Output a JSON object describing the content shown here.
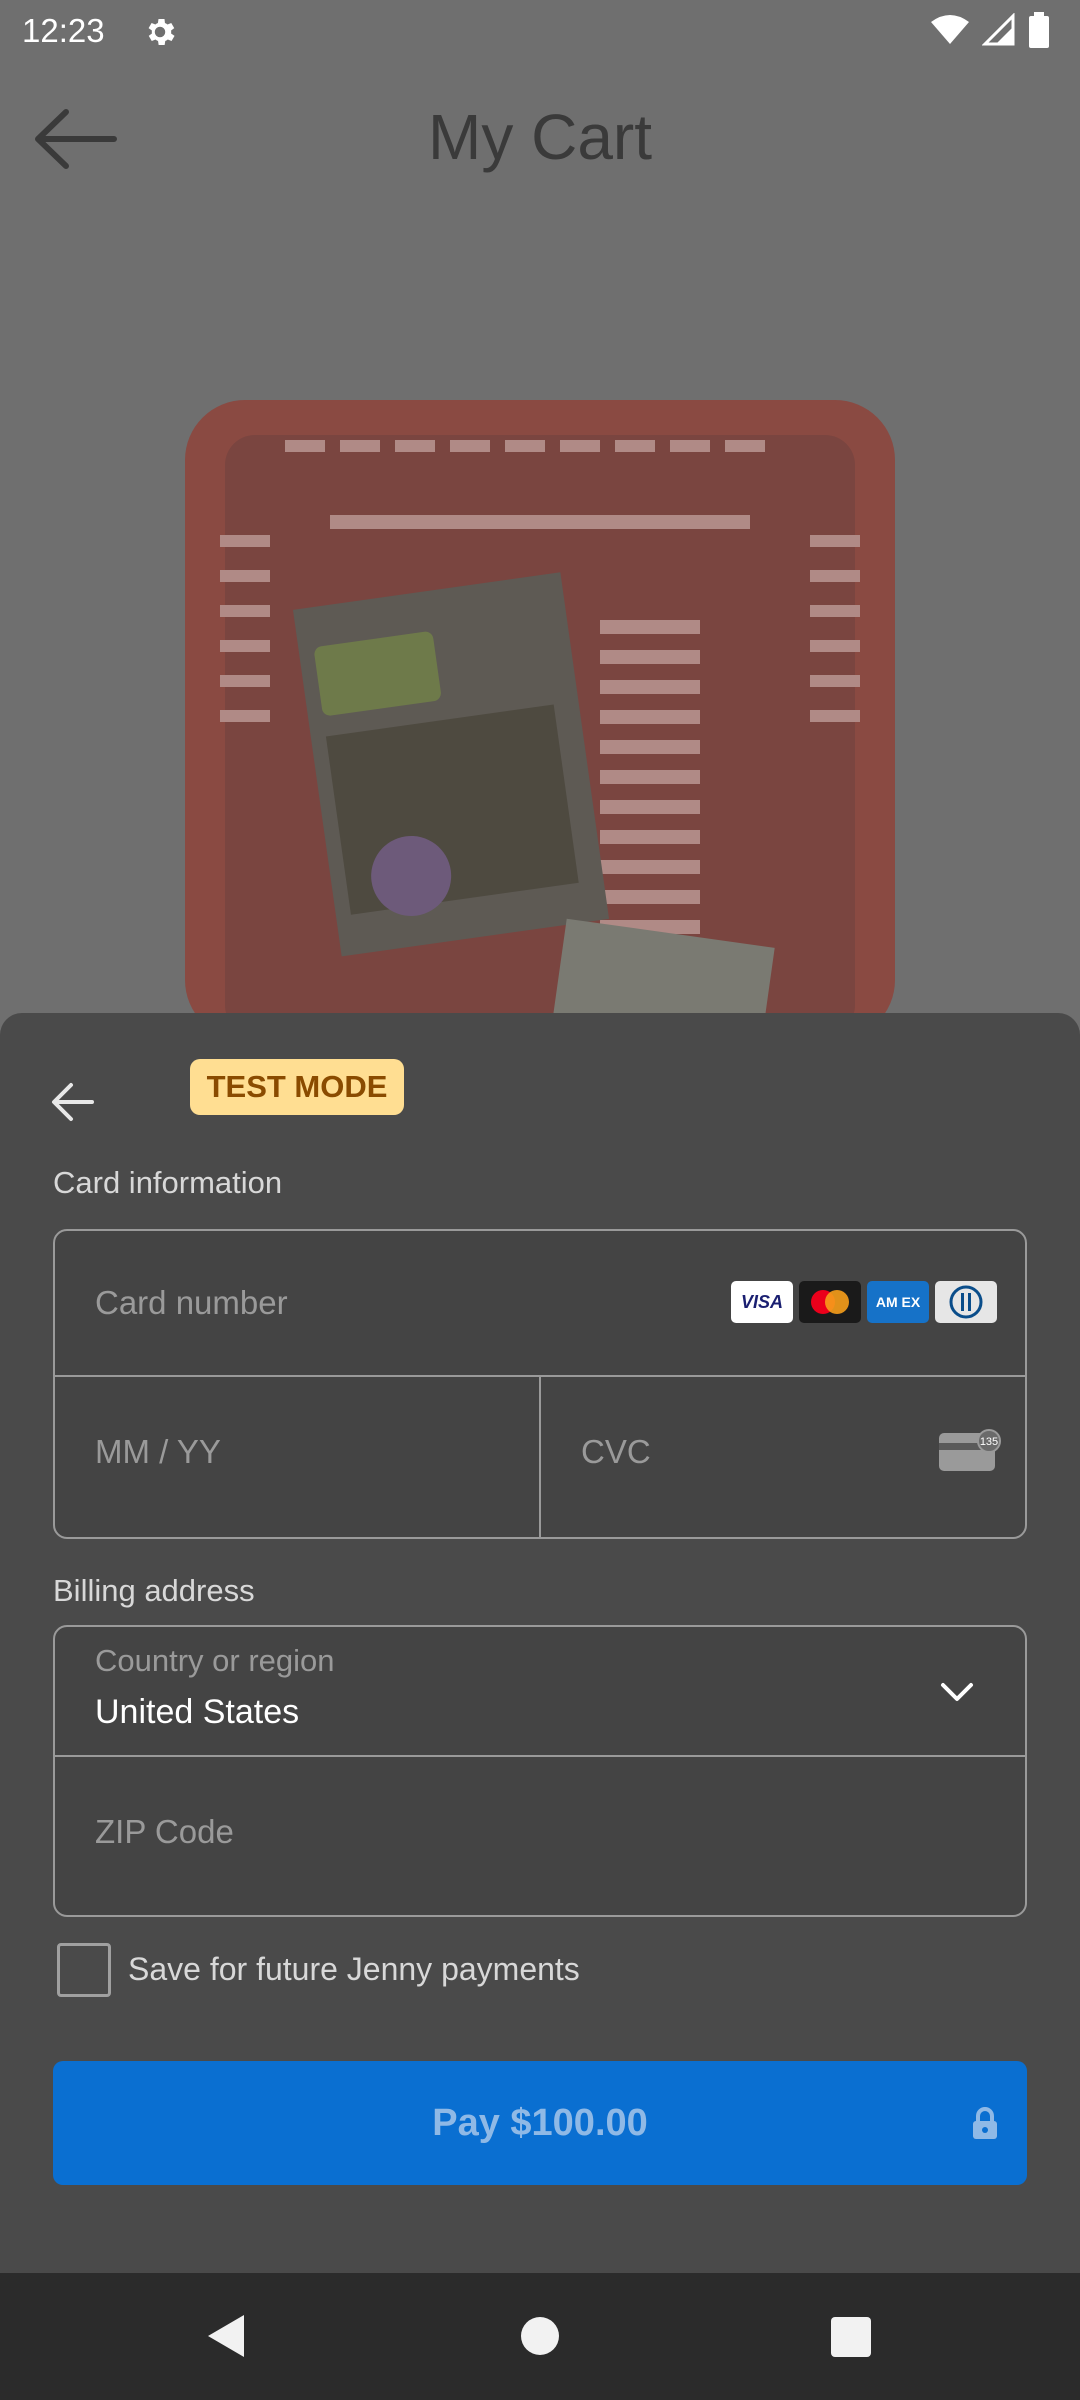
{
  "status_bar": {
    "time": "12:23"
  },
  "header": {
    "title": "My Cart"
  },
  "sheet": {
    "badge": "TEST MODE",
    "card_section_label": "Card information",
    "card_number_placeholder": "Card number",
    "expiry_placeholder": "MM / YY",
    "cvc_placeholder": "CVC",
    "brands": {
      "visa": "VISA",
      "amex": "AM EX"
    },
    "cvc_icon_text": "135",
    "billing_section_label": "Billing address",
    "country_label": "Country or region",
    "country_value": "United States",
    "zip_placeholder": "ZIP Code",
    "save_label": "Save for future Jenny payments",
    "pay_label": "Pay $100.00"
  },
  "colors": {
    "pay_button": "#0a6fd1",
    "badge_bg": "#ffde92",
    "badge_text": "#8a4b00",
    "sheet_bg": "#4a4a4a"
  }
}
